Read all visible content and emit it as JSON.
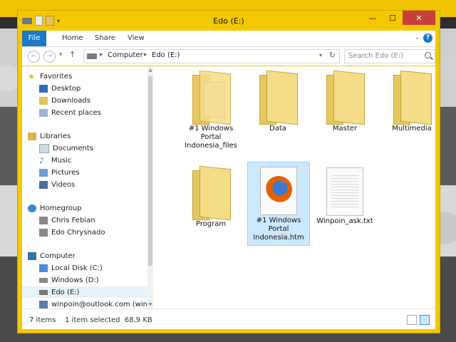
{
  "window": {
    "title": "Edo (E:)",
    "controls": {
      "minimize": "—",
      "maximize": "☐",
      "close": "✕"
    }
  },
  "ribbon": {
    "tabs": [
      "File",
      "Home",
      "Share",
      "View"
    ],
    "expand": "⌄",
    "help": "?"
  },
  "nav": {
    "back": "←",
    "forward": "→",
    "recent": "▾",
    "up": "↑",
    "address": [
      "Computer",
      "Edo (E:)"
    ],
    "search_placeholder": "Search Edo (E:)"
  },
  "sidebar": {
    "items": [
      {
        "label": "Favorites",
        "icon": "star-icon"
      },
      {
        "label": "Desktop",
        "icon": "desktop-icon"
      },
      {
        "label": "Downloads",
        "icon": "downloads-icon"
      },
      {
        "label": "Recent places",
        "icon": "recent-places-icon"
      },
      {
        "label": "Libraries",
        "icon": "libraries-icon"
      },
      {
        "label": "Documents",
        "icon": "documents-icon"
      },
      {
        "label": "Music",
        "icon": "music-icon"
      },
      {
        "label": "Pictures",
        "icon": "pictures-icon"
      },
      {
        "label": "Videos",
        "icon": "videos-icon"
      },
      {
        "label": "Homegroup",
        "icon": "homegroup-icon"
      },
      {
        "label": "Chris Febian",
        "icon": "user-icon"
      },
      {
        "label": "Edo Chrysnado",
        "icon": "user-icon"
      },
      {
        "label": "Computer",
        "icon": "computer-icon"
      },
      {
        "label": "Local Disk (C:)",
        "icon": "drive-icon"
      },
      {
        "label": "Windows (D:)",
        "icon": "drive-icon"
      },
      {
        "label": "Edo (E:)",
        "icon": "usb-drive-icon"
      },
      {
        "label": "winpoin@outlook.com (winpoin",
        "icon": "network-icon"
      }
    ]
  },
  "files": [
    {
      "name": "#1 Windows Portal Indonesia_files",
      "type": "folder-with-document"
    },
    {
      "name": "Data",
      "type": "folder"
    },
    {
      "name": "Master",
      "type": "folder"
    },
    {
      "name": "Multimedia",
      "type": "folder"
    },
    {
      "name": "Program",
      "type": "folder"
    },
    {
      "name": "#1 Windows Portal Indonesia.htm",
      "type": "firefox-html",
      "selected": true
    },
    {
      "name": "Winpoin_ask.txt",
      "type": "text"
    }
  ],
  "status": {
    "count": "7 items",
    "selection": "1 item selected  68,9 KB"
  },
  "colors": {
    "frame": "#f4c800",
    "accent": "#1979ca",
    "selection": "#cce8ff"
  }
}
